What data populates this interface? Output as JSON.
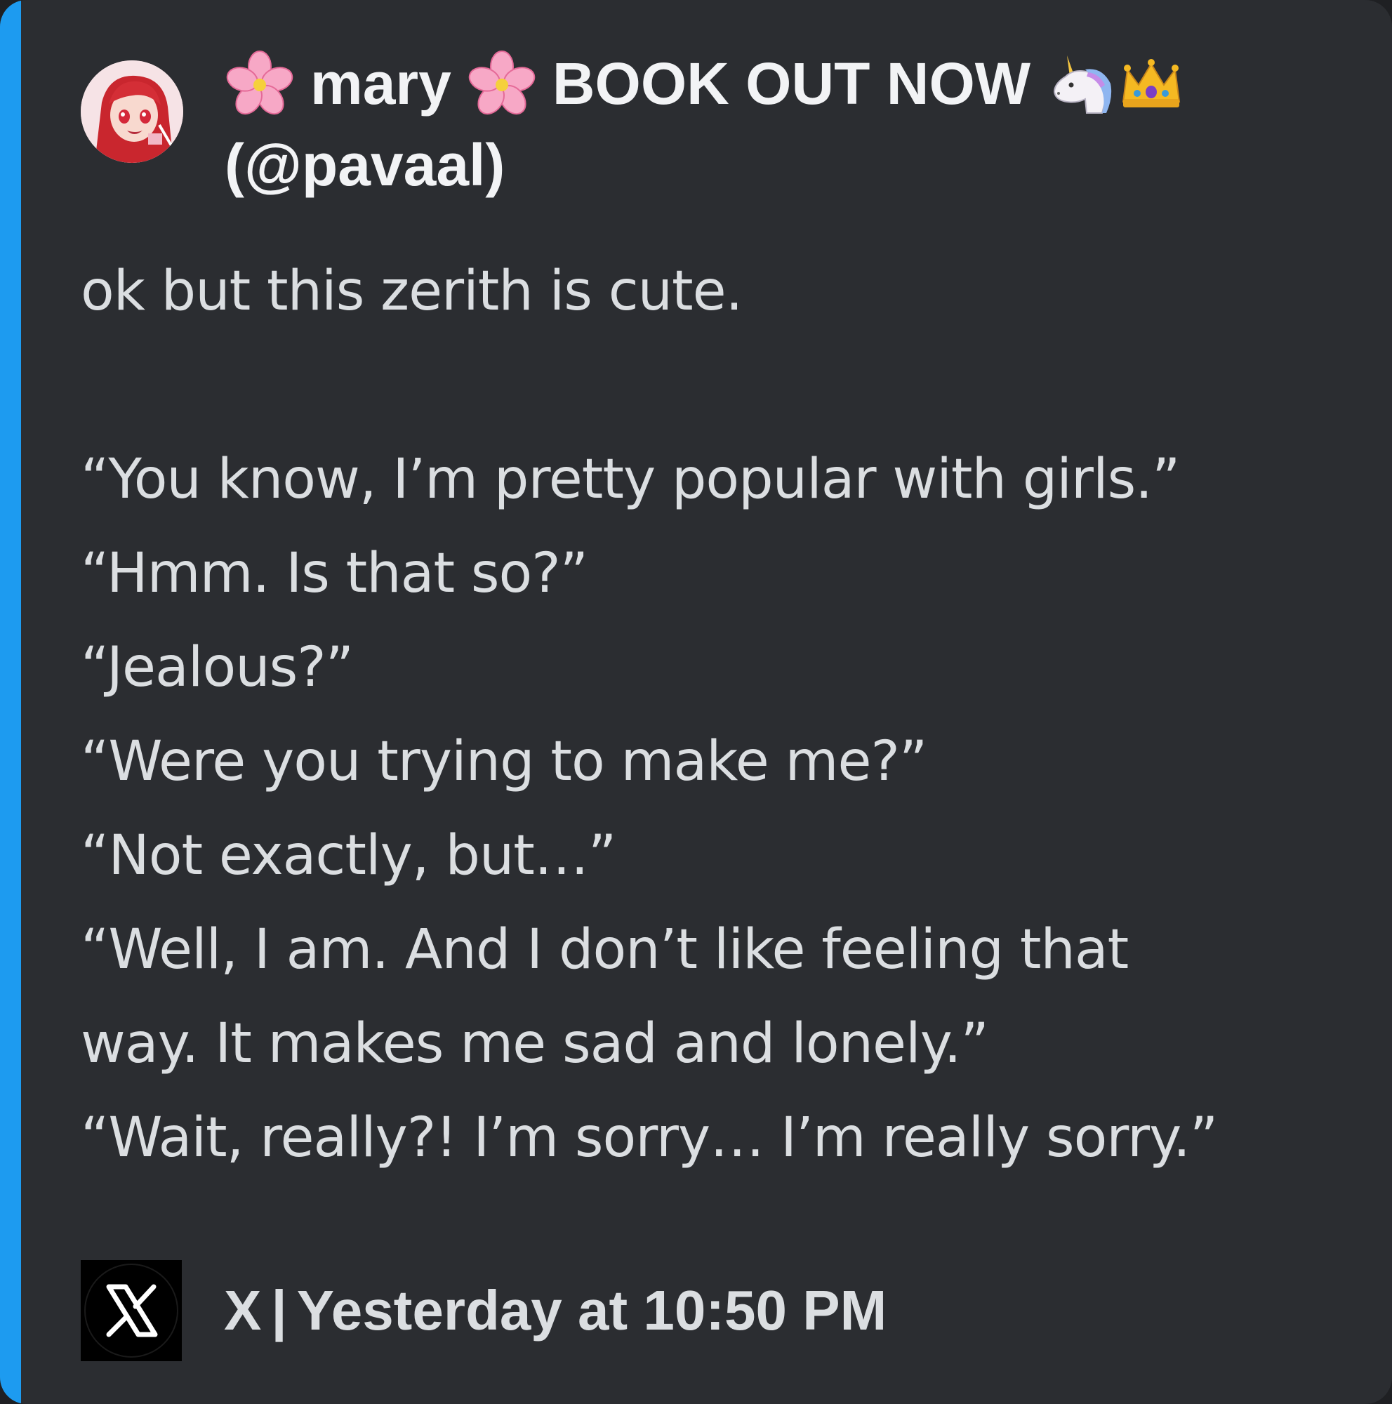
{
  "embed": {
    "accent_color": "#1d9bf0",
    "background_color": "#2b2d31"
  },
  "author": {
    "avatar_icon": "anime-avatar-icon",
    "name_parts": {
      "flower_icon": "cherry-blossom-icon",
      "name": "mary",
      "book_text": "BOOK OUT NOW",
      "unicorn_icon": "unicorn-icon",
      "crown_icon": "crown-icon"
    },
    "handle": "(@pavaal)"
  },
  "description": {
    "lines": [
      "ok but this zerith is cute.",
      "",
      "“You know, I’m pretty popular with girls.”",
      "“Hmm. Is that so?”",
      "“Jealous?”",
      "“Were you trying to make me?”",
      "“Not exactly, but…”",
      "“Well, I am. And I don’t like feeling that",
      "way. It makes me sad and lonely.”",
      "“Wait, really?! I’m sorry… I’m really sorry.”"
    ]
  },
  "footer": {
    "icon": "x-logo-icon",
    "provider": "X",
    "separator": "|",
    "timestamp": "Yesterday at 10:50 PM"
  }
}
